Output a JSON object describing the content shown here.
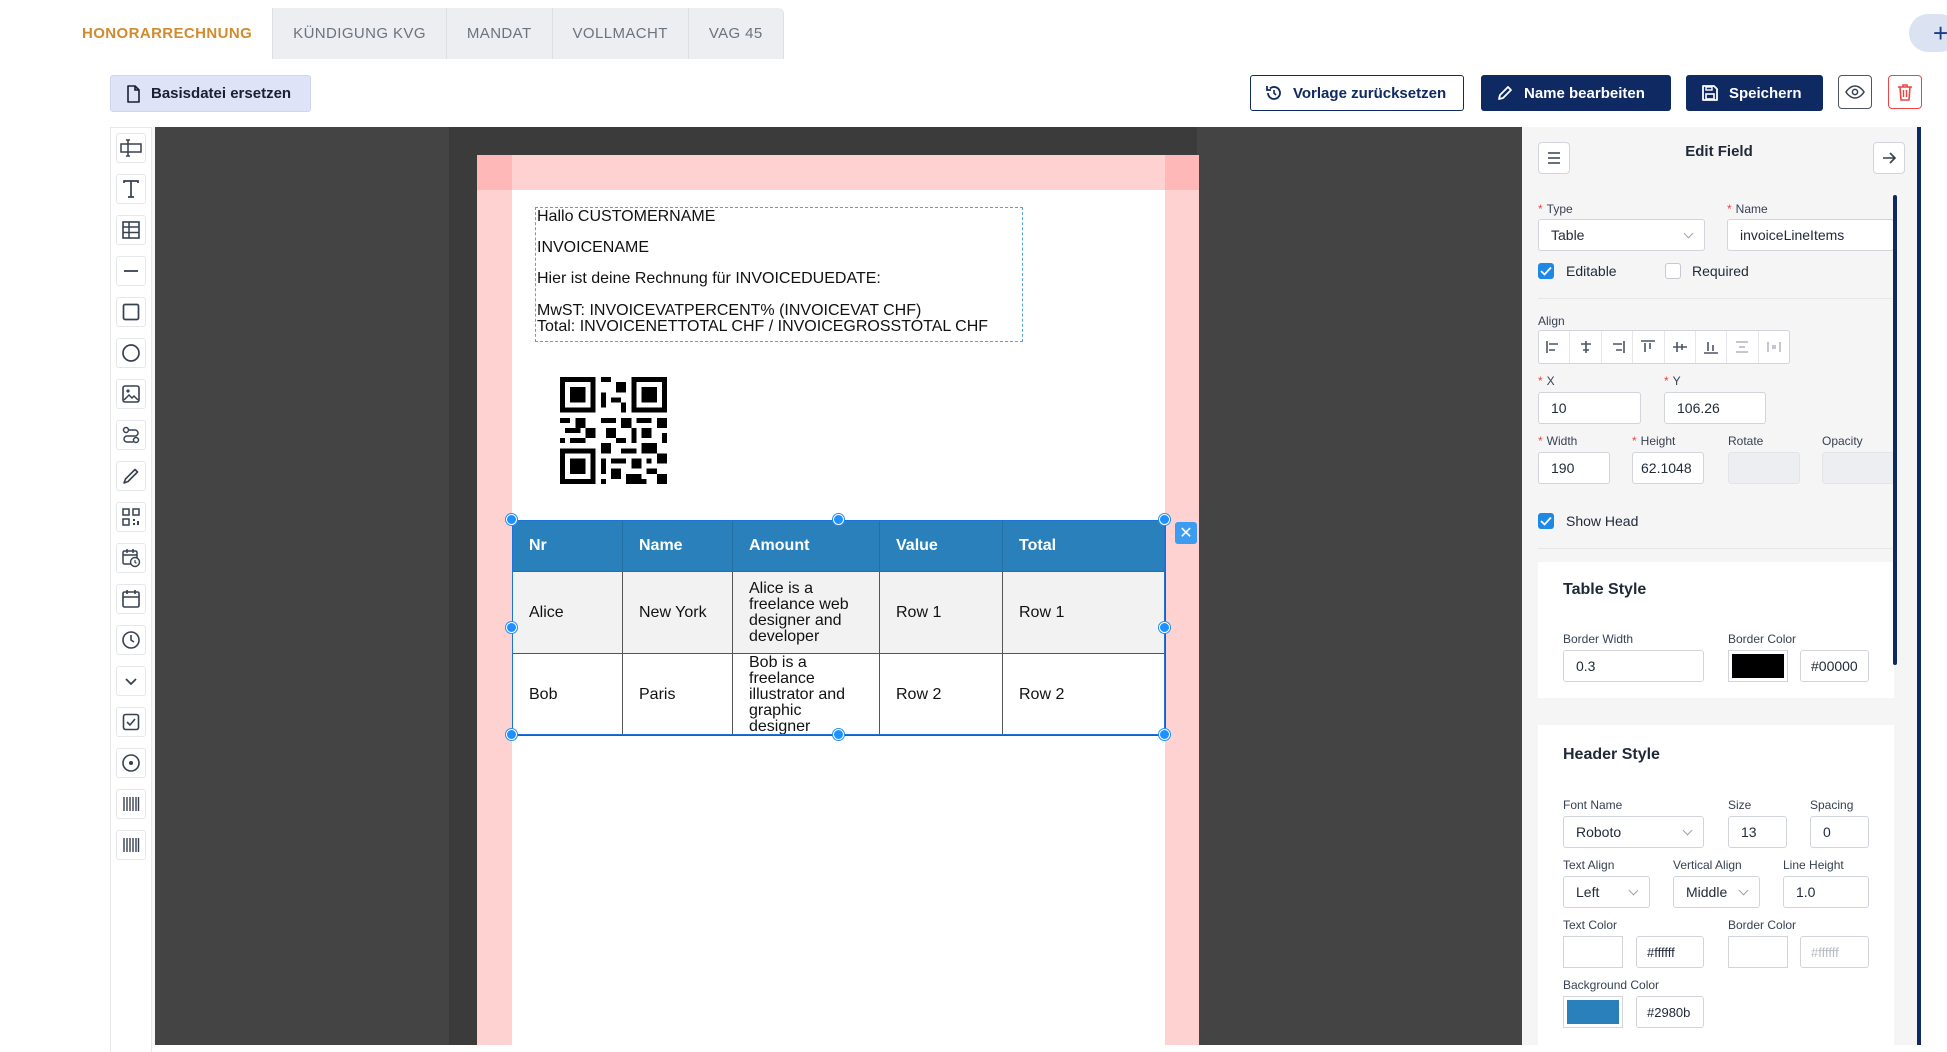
{
  "tabs": [
    {
      "label": "HONORARRECHNUNG",
      "active": true
    },
    {
      "label": "KÜNDIGUNG KVG",
      "active": false
    },
    {
      "label": "MANDAT",
      "active": false
    },
    {
      "label": "VOLLMACHT",
      "active": false
    },
    {
      "label": "VAG 45",
      "active": false
    }
  ],
  "toolbar": {
    "replace_base": "Basisdatei ersetzen",
    "reset_template": "Vorlage zurücksetzen",
    "edit_name": "Name bearbeiten",
    "save": "Speichern"
  },
  "tools": [
    "text-field-icon",
    "text-icon",
    "table-icon",
    "line-icon",
    "rectangle-icon",
    "ellipse-icon",
    "image-icon",
    "svg-icon",
    "signature-icon",
    "qrcode-icon",
    "date-time-icon",
    "date-icon",
    "time-icon",
    "select-icon",
    "checkbox-icon",
    "radio-icon",
    "barcode-icon",
    "barcode-alt-icon"
  ],
  "document": {
    "greeting": "Hallo CUSTOMERNAME",
    "invoice_name": "INVOICENAME",
    "due_line": "Hier ist deine Rechnung für INVOICEDUEDATE:",
    "vat_line": "MwST: INVOICEVATPERCENT% (INVOICEVAT CHF)",
    "total_line": "Total: INVOICENETTOTAL CHF / INVOICEGROSSTOTAL CHF"
  },
  "table": {
    "headers": [
      "Nr",
      "Name",
      "Amount",
      "Value",
      "Total"
    ],
    "rows": [
      [
        "Alice",
        "New York",
        "Alice is a freelance web designer and developer",
        "Row 1",
        "Row 1"
      ],
      [
        "Bob",
        "Paris",
        "Bob is a freelance illustrator and graphic designer",
        "Row 2",
        "Row 2"
      ]
    ],
    "amount_lines": [
      [
        "Alice is a",
        "freelance web",
        "designer and",
        "developer"
      ],
      [
        "Bob is a",
        "freelance",
        "illustrator and",
        "graphic",
        "designer"
      ]
    ],
    "header_color": "#2980ba"
  },
  "panel": {
    "title": "Edit Field",
    "type_label": "Type",
    "type_value": "Table",
    "name_label": "Name",
    "name_value": "invoiceLineItems",
    "editable_label": "Editable",
    "editable": true,
    "required_label": "Required",
    "required": false,
    "align_label": "Align",
    "x_label": "X",
    "x_value": "10",
    "y_label": "Y",
    "y_value": "106.26",
    "width_label": "Width",
    "width_value": "190",
    "height_label": "Height",
    "height_value": "62.1048",
    "rotate_label": "Rotate",
    "opacity_label": "Opacity",
    "show_head_label": "Show Head",
    "show_head": true,
    "table_style": {
      "title": "Table Style",
      "border_width_label": "Border Width",
      "border_width": "0.3",
      "border_color_label": "Border Color",
      "border_color": "#00000"
    },
    "header_style": {
      "title": "Header Style",
      "font_name_label": "Font Name",
      "font_name": "Roboto",
      "size_label": "Size",
      "size": "13",
      "spacing_label": "Spacing",
      "spacing": "0",
      "text_align_label": "Text Align",
      "text_align": "Left",
      "vertical_align_label": "Vertical Align",
      "vertical_align": "Middle",
      "line_height_label": "Line Height",
      "line_height": "1.0",
      "text_color_label": "Text Color",
      "text_color": "#ffffff",
      "border_color_label": "Border Color",
      "border_color": "#ffffff",
      "background_color_label": "Background Color",
      "background_color": "#2980b"
    }
  },
  "colors": {
    "navy": "#0f2a63",
    "accent_tab": "#d28a2e",
    "table_header": "#2980ba",
    "selection": "#1e73d8"
  }
}
